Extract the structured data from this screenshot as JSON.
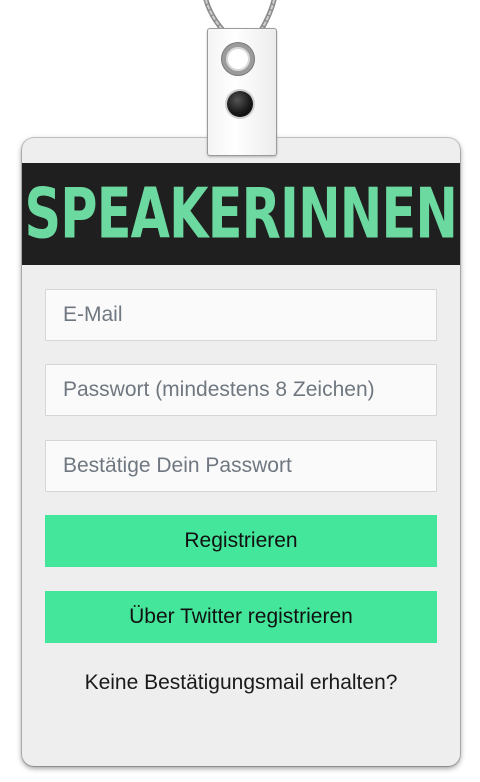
{
  "badge": {
    "logo_text": "SPEAKERINNEN"
  },
  "form": {
    "email_placeholder": "E-Mail",
    "password_placeholder": "Passwort (mindestens 8 Zeichen)",
    "confirm_placeholder": "Bestätige Dein Passwort",
    "register_label": "Registrieren",
    "twitter_label": "Über Twitter registrieren",
    "no_mail_link": "Keine Bestätigungsmail erhalten?"
  },
  "colors": {
    "accent": "#44e69b",
    "logo_green": "#6cd9a0",
    "logo_bar": "#1f1f1f",
    "card_bg": "#eeeeee"
  },
  "icons": {
    "lanyard": "lanyard-cord-icon",
    "clip": "badge-clip-icon"
  }
}
